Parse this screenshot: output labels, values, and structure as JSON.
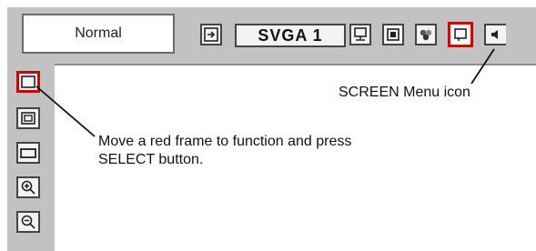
{
  "toolbar": {
    "mode_label": "Normal",
    "signal_label": "SVGA 1",
    "icons": [
      "input-icon",
      "pc-adjust-icon",
      "image-select-icon",
      "color-adjust-icon",
      "screen-menu-icon",
      "sound-icon"
    ]
  },
  "sidebar": {
    "items": [
      "normal-screen-icon",
      "true-screen-icon",
      "wide-screen-icon",
      "digital-zoom-plus-icon",
      "digital-zoom-minus-icon"
    ]
  },
  "callouts": {
    "screen_menu": "SCREEN Menu icon",
    "instruction_line1": "Move a red frame to function and press",
    "instruction_line2": "SELECT button."
  },
  "colors": {
    "selection": "#c70000",
    "panel": "#c2c2c2"
  }
}
